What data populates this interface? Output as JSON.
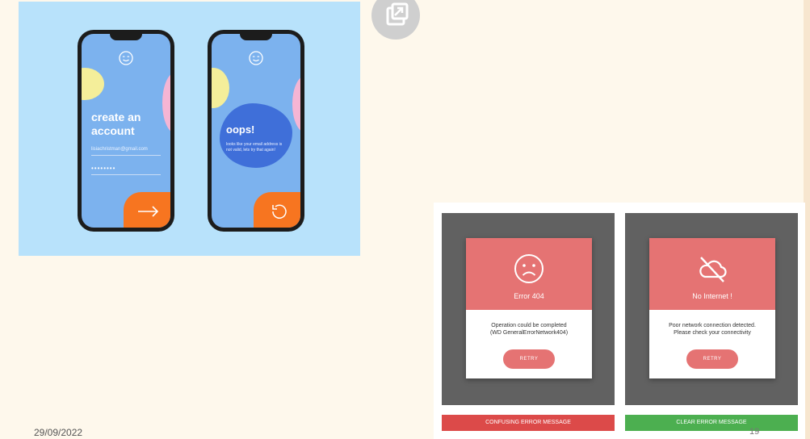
{
  "illustration": {
    "phone1": {
      "title": "create an account",
      "email": "lisiachristman@gmail.com",
      "password": "••••••••"
    },
    "phone2": {
      "title": "oops!",
      "message": "looks like your email address is not valid, lets try that again!"
    },
    "icons": [
      "smile-icon",
      "arrow-right-icon",
      "undo-icon"
    ]
  },
  "popout": {
    "icon": "open-external-icon"
  },
  "comparison": {
    "left": {
      "icon": "sad-face-icon",
      "title": "Error 404",
      "message_line1": "Operation could be completed",
      "message_line2": "(WD GeneralErrorNetwork404)",
      "button": "RETRY",
      "caption": "CONFUSING ERROR MESSAGE",
      "caption_color": "#dc4a49"
    },
    "right": {
      "icon": "cloud-off-icon",
      "title": "No Internet !",
      "message_line1": "Poor network connection detected.",
      "message_line2": "Please check your connectivity",
      "button": "RETRY",
      "caption": "CLEAR ERROR MESSAGE",
      "caption_color": "#4caf50"
    }
  },
  "footer": {
    "date": "29/09/2022",
    "page": "19"
  },
  "colors": {
    "page_bg": "#fef8ec",
    "illustration_bg": "#b8e2fb",
    "card_header": "#e57373",
    "panel_bg": "#616161",
    "action_orange": "#f77520"
  }
}
